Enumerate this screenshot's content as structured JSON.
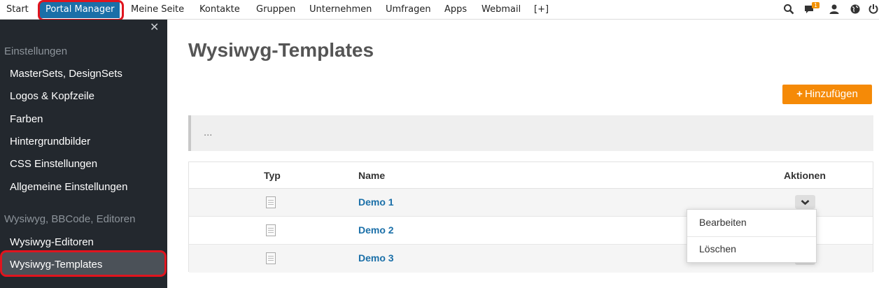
{
  "topnav": {
    "items": [
      "Start",
      "Portal Manager",
      "Meine Seite",
      "Kontakte",
      "Gruppen",
      "Unternehmen",
      "Umfragen",
      "Apps",
      "Webmail",
      "[+]"
    ],
    "active": "Portal Manager",
    "notifications_count": "1",
    "icons": [
      "search-icon",
      "chat-icon",
      "user-icon",
      "globe-icon",
      "power-icon"
    ]
  },
  "sidebar": {
    "close_glyph": "✕",
    "section1": "Einstellungen",
    "items1": [
      "MasterSets, DesignSets",
      "Logos & Kopfzeile",
      "Farben",
      "Hintergrundbilder",
      "CSS Einstellungen",
      "Allgemeine Einstellungen"
    ],
    "section2": "Wysiwyg, BBCode, Editoren",
    "items2": [
      "Wysiwyg-Editoren",
      "Wysiwyg-Templates"
    ],
    "active": "Wysiwyg-Templates"
  },
  "main": {
    "title": "Wysiwyg-Templates",
    "add_button": "Hinzufügen",
    "add_glyph": "+",
    "info_text": "...",
    "columns": [
      "Typ",
      "Name",
      "Aktionen"
    ],
    "rows": [
      {
        "type_icon": "document-icon",
        "name": "Demo 1"
      },
      {
        "type_icon": "document-icon",
        "name": "Demo 2"
      },
      {
        "type_icon": "document-icon",
        "name": "Demo 3"
      }
    ],
    "actions_menu": [
      "Bearbeiten",
      "Löschen"
    ]
  },
  "colors": {
    "accent": "#1a6fa8",
    "button": "#f58a07",
    "sidebar_bg": "#23282e",
    "highlight": "#e0141e"
  }
}
